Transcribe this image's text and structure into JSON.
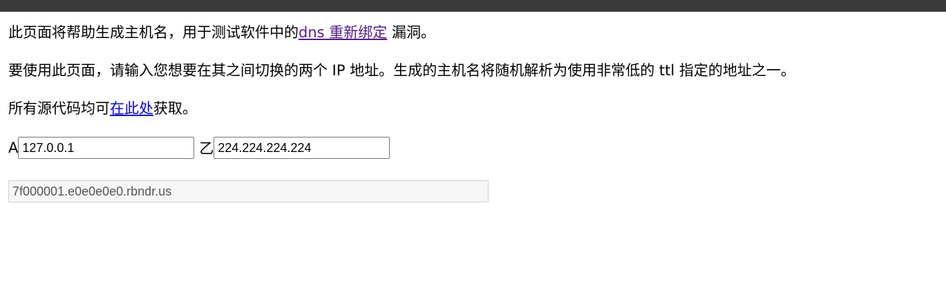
{
  "intro": {
    "prefix": "此页面将帮助生成主机名，用于测试软件中的",
    "link_text": "dns 重新绑定",
    "suffix": " 漏洞。"
  },
  "usage": {
    "text": "要使用此页面，请输入您想要在其之间切换的两个 IP 地址。生成的主机名将随机解析为使用非常低的 ttl 指定的地址之一。"
  },
  "source": {
    "prefix": "所有源代码均可",
    "link_text": "在此处",
    "suffix": "获取。"
  },
  "form": {
    "label_a": "A",
    "ip_a": "127.0.0.1",
    "label_b": "乙",
    "ip_b": "224.224.224.224"
  },
  "output": {
    "hostname": "7f000001.e0e0e0e0.rbndr.us"
  }
}
